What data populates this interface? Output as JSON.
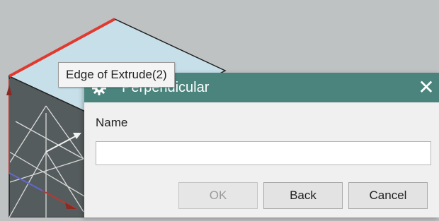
{
  "tooltip": {
    "text": "Edge of Extrude(2)"
  },
  "dialog": {
    "title": "Perpendicular",
    "icon": "gear-icon",
    "close_icon": "close-icon",
    "close_glyph": "✕",
    "name_label": "Name",
    "name_value": "",
    "buttons": {
      "ok": "OK",
      "back": "Back",
      "cancel": "Cancel"
    },
    "ok_enabled": false
  },
  "colors": {
    "titlebar": "#4a847d",
    "viewport_bg": "#bfc2c3",
    "top_face": "#c6dfe8",
    "front_face": "#555c5d",
    "highlight_edge": "#e03a2f"
  }
}
